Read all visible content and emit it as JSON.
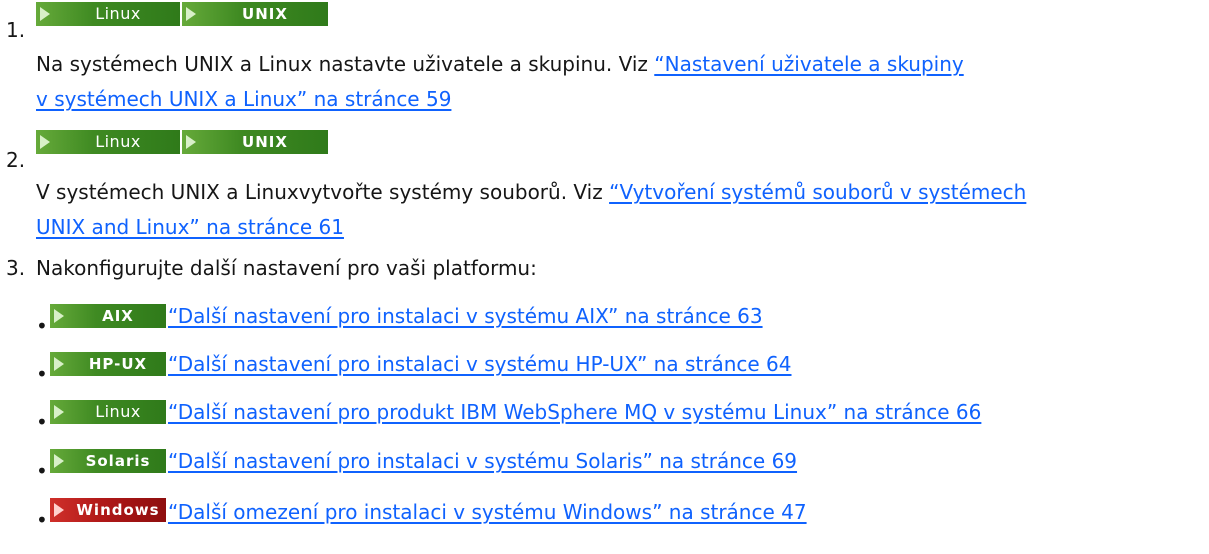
{
  "steps": [
    {
      "number": "1.",
      "badges": [
        "Linux",
        "UNIX"
      ],
      "text": "Na systémech UNIX a Linux nastavte uživatele a skupinu. Viz ",
      "link_line1": "“Nastavení uživatele a skupiny",
      "link_line2": "v systémech UNIX a Linux” na stránce 59"
    },
    {
      "number": "2.",
      "badges": [
        "Linux",
        "UNIX"
      ],
      "text": "V systémech UNIX a Linuxvytvořte systémy souborů. Viz ",
      "link_line1": "“Vytvoření systémů souborů v systémech",
      "link_line2": "UNIX and Linux” na stránce 61"
    },
    {
      "number": "3.",
      "text": "Nakonfigurujte další nastavení pro vaši platformu:"
    }
  ],
  "bullet_symbol": "•",
  "bullets": [
    {
      "badge": "AIX",
      "badge_color": "#3f8a22",
      "link": "“Další nastavení pro instalaci v systému AIX” na stránce 63"
    },
    {
      "badge": "HP-UX",
      "badge_color": "#3f8a22",
      "link": "“Další nastavení pro instalaci v systému HP-UX” na stránce 64"
    },
    {
      "badge": "Linux",
      "badge_color": "#3f8a22",
      "link": "“Další nastavení pro produkt IBM WebSphere MQ v systému Linux” na stránce 66"
    },
    {
      "badge": "Solaris",
      "badge_color": "#3f8a22",
      "link": "“Další nastavení pro instalaci v systému Solaris” na stránce 69"
    },
    {
      "badge": "Windows",
      "badge_color": "#b01818",
      "link": "“Další omezení pro instalaci v systému Windows” na stránce 47"
    }
  ],
  "colors": {
    "text": "#161616",
    "link": "#0f62fe",
    "platform_badge": "#3f8a22",
    "windows_badge": "#b01818"
  }
}
